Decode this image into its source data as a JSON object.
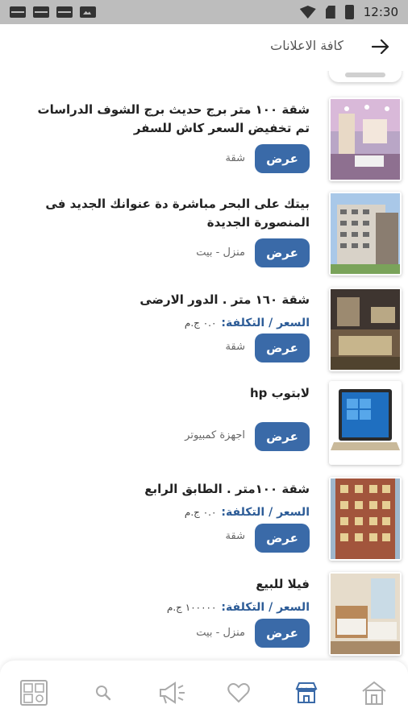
{
  "status_bar": {
    "time": "12:30"
  },
  "header": {
    "title": "كافة الاعلانات"
  },
  "listings": [
    {
      "title": "شقة ١٠٠ متر برج حديث برج الشوف الدراسات تم تخفيض السعر كاش للسفر",
      "button": "عرض",
      "category": "شقة"
    },
    {
      "title": "بيتك على البحر مباشرة دة عنوانك الجديد فى المنصورة الجديدة",
      "button": "عرض",
      "category": "منزل - بيت"
    },
    {
      "title": "شقة ١٦٠ متر . الدور الارضى",
      "price_label": "السعر / التكلفة:",
      "price_value": "٠.٠ ج.م",
      "button": "عرض",
      "category": "شقة"
    },
    {
      "title": "لابتوب hp",
      "button": "عرض",
      "category": "اجهزة كمبيوتر"
    },
    {
      "title": "شقة ١٠٠متر . الطابق الرابع",
      "price_label": "السعر / التكلفة:",
      "price_value": "٠.٠ ج.م",
      "button": "عرض",
      "category": "شقة"
    },
    {
      "title": "فيلا للبيع",
      "price_label": "السعر / التكلفة:",
      "price_value": "١٠٠٠٠٠ ج.م",
      "button": "عرض",
      "category": "منزل - بيت"
    }
  ],
  "bottom_nav": [
    {
      "icon": "home-icon"
    },
    {
      "icon": "store-icon",
      "active": true
    },
    {
      "icon": "heart-icon"
    },
    {
      "icon": "megaphone-icon"
    },
    {
      "icon": "search-icon"
    },
    {
      "icon": "grid-apps-icon"
    }
  ],
  "colors": {
    "accent": "#3a6aa8",
    "price_label": "#2d5c97"
  }
}
